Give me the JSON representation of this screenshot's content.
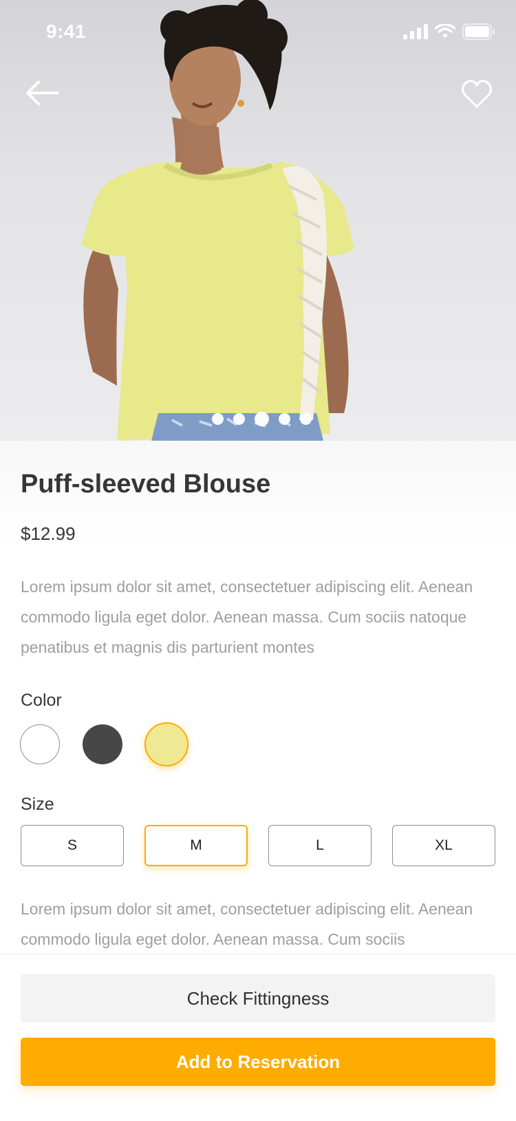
{
  "status_bar": {
    "time": "9:41"
  },
  "hero": {
    "page_count": 5,
    "active_index": 2
  },
  "product": {
    "title": "Puff-sleeved Blouse",
    "price": "$12.99",
    "description": "Lorem ipsum dolor sit amet, consectetuer adipiscing elit. Aenean commodo ligula eget dolor. Aenean massa. Cum sociis natoque penatibus et magnis dis parturient montes",
    "description_more": "Lorem ipsum dolor sit amet, consectetuer adipiscing elit. Aenean commodo ligula eget dolor. Aenean massa. Cum sociis"
  },
  "color": {
    "label": "Color",
    "options": [
      "#FFFFFF",
      "#474747",
      "#F0E993"
    ],
    "selected_index": 2
  },
  "size": {
    "label": "Size",
    "options": [
      "S",
      "M",
      "L",
      "XL"
    ],
    "selected": "M"
  },
  "actions": {
    "secondary": "Check Fittingness",
    "primary": "Add to Reservation"
  },
  "colors": {
    "accent": "#FFAB00"
  }
}
